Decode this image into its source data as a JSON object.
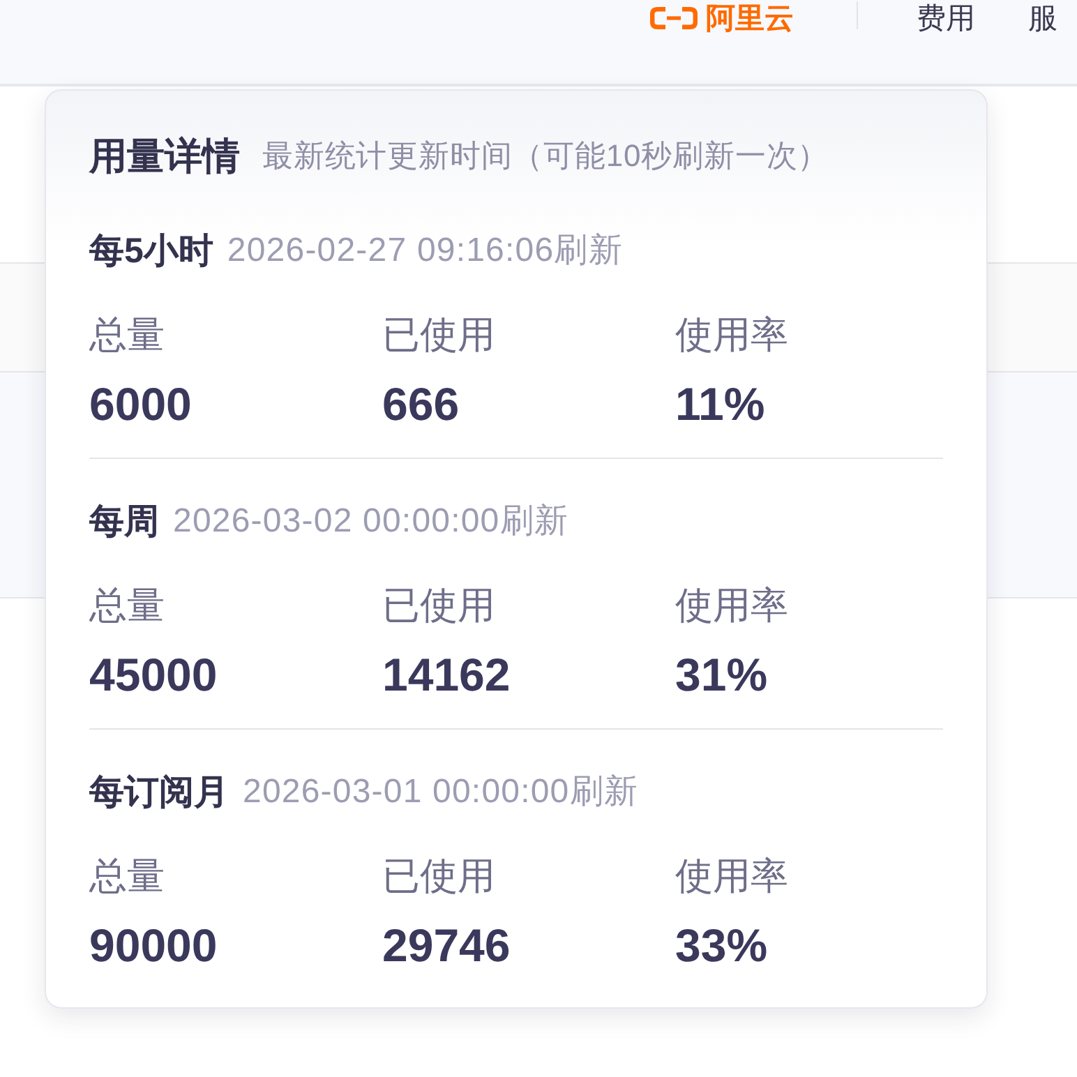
{
  "top_bar": {
    "logo_text": "阿里云",
    "nav": [
      "费用",
      "服"
    ]
  },
  "usage_popover": {
    "title": "用量详情",
    "subtitle": "最新统计更新时间（可能10秒刷新一次）",
    "sections": [
      {
        "period": "每5小时",
        "refresh_time": "2026-02-27 09:16:06刷新",
        "stats": [
          {
            "label": "总量",
            "value": "6000"
          },
          {
            "label": "已使用",
            "value": "666"
          },
          {
            "label": "使用率",
            "value": "11%"
          }
        ]
      },
      {
        "period": "每周",
        "refresh_time": "2026-03-02 00:00:00刷新",
        "stats": [
          {
            "label": "总量",
            "value": "45000"
          },
          {
            "label": "已使用",
            "value": "14162"
          },
          {
            "label": "使用率",
            "value": "31%"
          }
        ]
      },
      {
        "period": "每订阅月",
        "refresh_time": "2026-03-01 00:00:00刷新",
        "stats": [
          {
            "label": "总量",
            "value": "90000"
          },
          {
            "label": "已使用",
            "value": "29746"
          },
          {
            "label": "使用率",
            "value": "33%"
          }
        ]
      }
    ]
  }
}
